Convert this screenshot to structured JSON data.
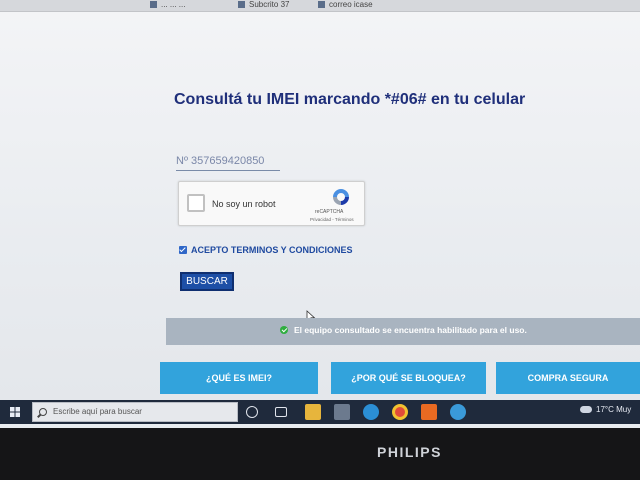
{
  "bookmarks": [
    {
      "label": "... ... ..."
    },
    {
      "label": "Subcrito 37"
    },
    {
      "label": "correo icase"
    }
  ],
  "main": {
    "title": "Consultá tu IMEI marcando *#06# en tu celular",
    "imei_input": {
      "value": "Nº 357659420850"
    },
    "recaptcha": {
      "checkbox_label": "No soy un robot",
      "brand": "reCAPTCHA",
      "links": "Privacidad - Términos"
    },
    "terms_label": "ACEPTO TERMINOS Y CONDICIONES",
    "search_button": "BUSCAR",
    "result_message": "El equipo consultado se encuentra habilitado para el uso."
  },
  "bottom_buttons": [
    {
      "label": "¿QUÉ ES IMEI?"
    },
    {
      "label": "¿POR QUÉ SE BLOQUEA?"
    },
    {
      "label": "COMPRA SEGURA"
    }
  ],
  "taskbar": {
    "search_placeholder": "Escribe aquí para buscar",
    "weather": "17°C  Muy"
  },
  "monitor_brand": "PHILIPS",
  "colors": {
    "title": "#1f2f7a",
    "button_primary": "#1d4fa6",
    "button_secondary": "#32a3dc",
    "success": "#2fae3f",
    "result_bar": "#a9b4c0"
  }
}
